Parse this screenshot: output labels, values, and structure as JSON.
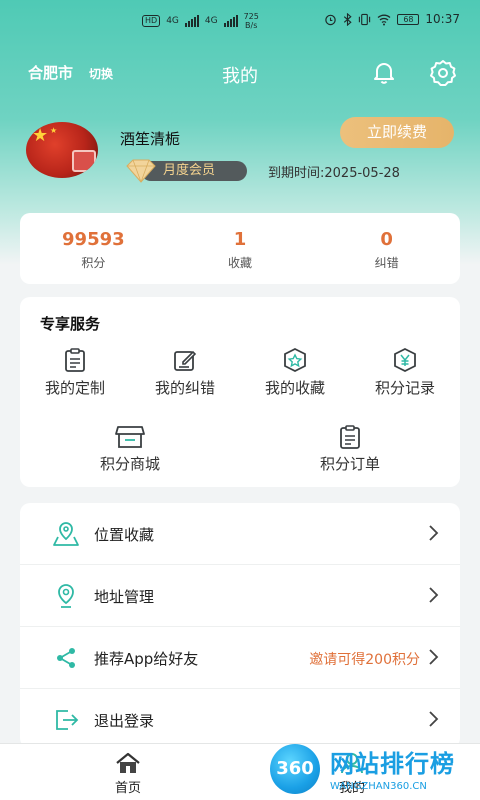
{
  "status_bar": {
    "net_pill": "HD",
    "sig1": "4G",
    "sig2": "4G",
    "speed_value": "725",
    "speed_unit": "B/s",
    "battery": "68",
    "time": "10:37"
  },
  "header": {
    "city": "合肥市",
    "city_switch": "切换",
    "title": "我的"
  },
  "profile": {
    "username": "酒笙清栀",
    "member_level": "月度会员",
    "expire_text": "到期时间:2025-05-28",
    "renew_button": "立即续费"
  },
  "stats": [
    {
      "value": "99593",
      "label": "积分"
    },
    {
      "value": "1",
      "label": "收藏"
    },
    {
      "value": "0",
      "label": "纠错"
    }
  ],
  "services": {
    "title": "专享服务",
    "items": [
      {
        "label": "我的定制",
        "icon": "clipboard-icon"
      },
      {
        "label": "我的纠错",
        "icon": "edit-icon"
      },
      {
        "label": "我的收藏",
        "icon": "star-badge-icon"
      },
      {
        "label": "积分记录",
        "icon": "yen-badge-icon"
      },
      {
        "label": "积分商城",
        "icon": "store-icon"
      },
      {
        "label": "积分订单",
        "icon": "order-clipboard-icon"
      }
    ]
  },
  "menu": [
    {
      "label": "位置收藏",
      "icon": "location-map-icon",
      "extra": ""
    },
    {
      "label": "地址管理",
      "icon": "location-pin-icon",
      "extra": ""
    },
    {
      "label": "推荐App给好友",
      "icon": "share-icon",
      "extra": "邀请可得200积分"
    },
    {
      "label": "退出登录",
      "icon": "logout-icon",
      "extra": ""
    }
  ],
  "tabbar": [
    {
      "label": "首页",
      "icon": "home-icon"
    },
    {
      "label": "我的",
      "icon": "user-icon"
    }
  ],
  "watermark": {
    "badge": "360",
    "title": "网站排行榜",
    "subtitle": "WANGZHAN360.CN"
  },
  "colors": {
    "accent": "#2fb9a5",
    "orange": "#e0713a",
    "gold": "#e6b46a"
  }
}
